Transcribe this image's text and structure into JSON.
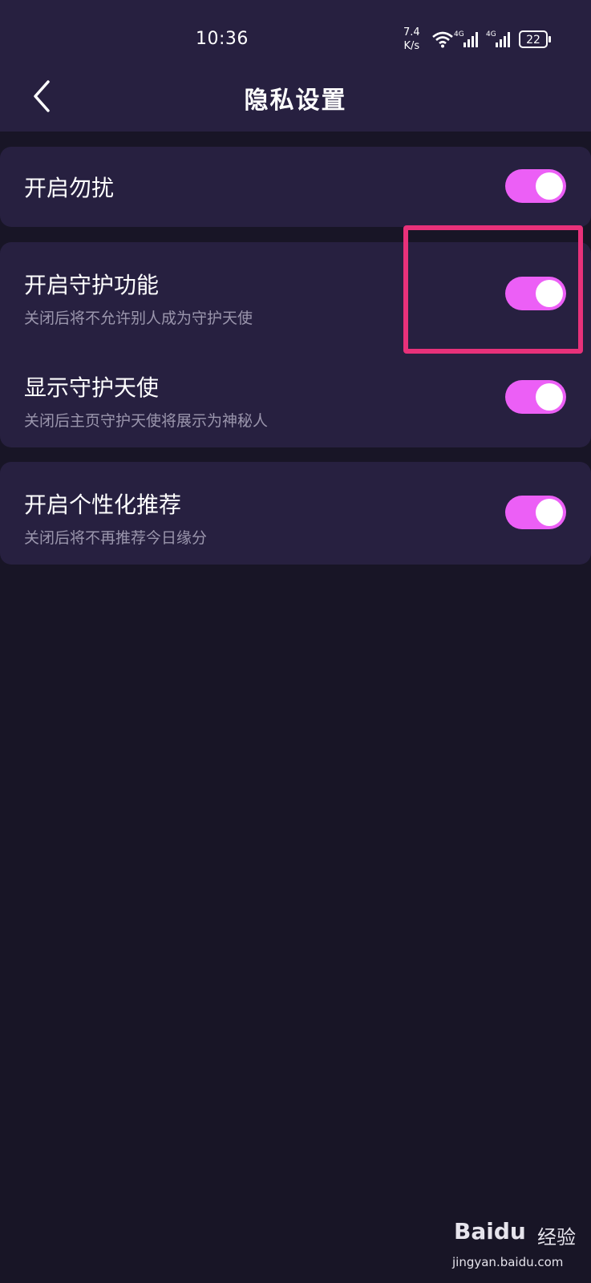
{
  "status_bar": {
    "time": "10:36",
    "net_speed_value": "7.4",
    "net_speed_unit": "K/s",
    "signal1_label": "4G",
    "signal2_label": "4G",
    "battery": "22"
  },
  "header": {
    "title": "隐私设置",
    "back_icon": "chevron-left-icon"
  },
  "settings": [
    {
      "label": "开启勿扰",
      "description": "",
      "enabled": true
    },
    {
      "label": "开启守护功能",
      "description": "关闭后将不允许别人成为守护天使",
      "enabled": true
    },
    {
      "label": "显示守护天使",
      "description": "关闭后主页守护天使将展示为神秘人",
      "enabled": true
    },
    {
      "label": "开启个性化推荐",
      "description": "关闭后将不再推荐今日缘分",
      "enabled": true
    }
  ],
  "colors": {
    "accent_toggle": "#ec5ff6",
    "highlight_box": "#e8317a",
    "header_bg": "#272040",
    "page_bg": "#181526"
  },
  "watermark": {
    "brand": "Baidu",
    "suffix": "经验",
    "url": "jingyan.baidu.com"
  }
}
